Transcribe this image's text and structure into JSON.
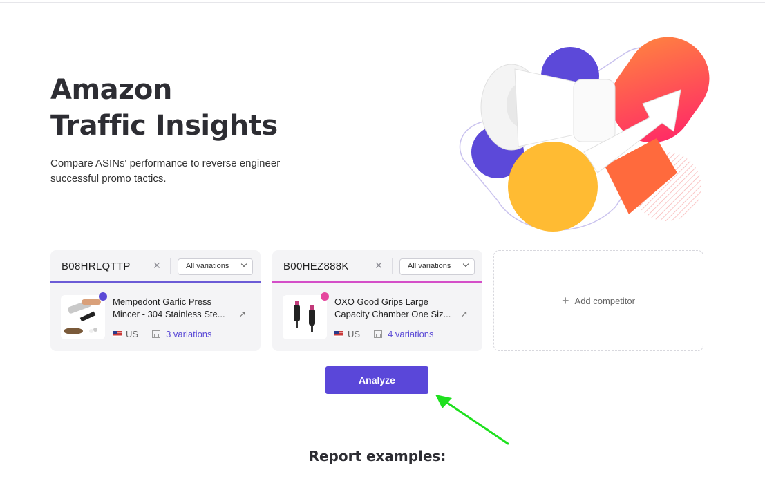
{
  "hero": {
    "title_line1": "Amazon",
    "title_line2": "Traffic Insights",
    "subtitle": "Compare ASINs' performance to reverse engineer successful promo tactics."
  },
  "competitors": [
    {
      "asin": "B08HRLQTTP",
      "variations_select": "All variations",
      "product_line1": "Mempedont Garlic Press",
      "product_line2": "Mincer - 304 Stainless Ste...",
      "marketplace": "US",
      "variations_link": "3 variations",
      "color": "#5a49d6"
    },
    {
      "asin": "B00HEZ888K",
      "variations_select": "All variations",
      "product_line1": "OXO Good Grips Large",
      "product_line2": "Capacity Chamber One Siz...",
      "marketplace": "US",
      "variations_link": "4 variations",
      "color": "#e5469e"
    }
  ],
  "add_competitor_label": "Add competitor",
  "analyze_button": "Analyze",
  "report_heading": "Report examples:",
  "colors": {
    "accent": "#5a47d9",
    "annotation_arrow": "#1ee01e"
  }
}
